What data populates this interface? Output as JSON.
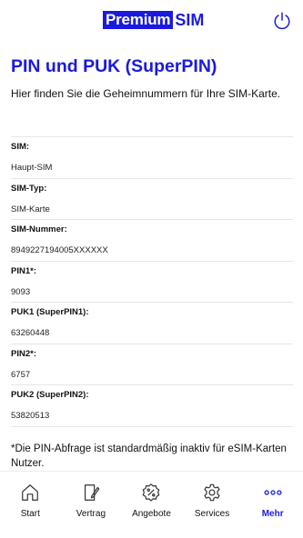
{
  "header": {
    "logo_part1": "Premium",
    "logo_part2": "SIM",
    "power_icon": "power-icon"
  },
  "page": {
    "title": "PIN und PUK (SuperPIN)",
    "description": "Hier finden Sie die Geheimnummern für Ihre SIM-Karte."
  },
  "fields": [
    {
      "label": "SIM:",
      "value": "Haupt-SIM"
    },
    {
      "label": "SIM-Typ:",
      "value": "SIM-Karte"
    },
    {
      "label": "SIM-Nummer:",
      "value": "8949227194005XXXXXX"
    },
    {
      "label": "PIN1*:",
      "value": "9093"
    },
    {
      "label": "PUK1 (SuperPIN1):",
      "value": "63260448"
    },
    {
      "label": "PIN2*:",
      "value": "6757"
    },
    {
      "label": "PUK2 (SuperPIN2):",
      "value": "53820513"
    }
  ],
  "footnote": "*Die PIN-Abfrage ist standardmäßig inaktiv für eSIM-Karten Nutzer.",
  "tabbar": {
    "accent_color": "#1a1adf",
    "items": [
      {
        "label": "Start",
        "icon": "home-icon",
        "active": false
      },
      {
        "label": "Vertrag",
        "icon": "contract-icon",
        "active": false
      },
      {
        "label": "Angebote",
        "icon": "percent-badge-icon",
        "active": false
      },
      {
        "label": "Services",
        "icon": "gear-icon",
        "active": false
      },
      {
        "label": "Mehr",
        "icon": "more-dots-icon",
        "active": true
      }
    ]
  }
}
